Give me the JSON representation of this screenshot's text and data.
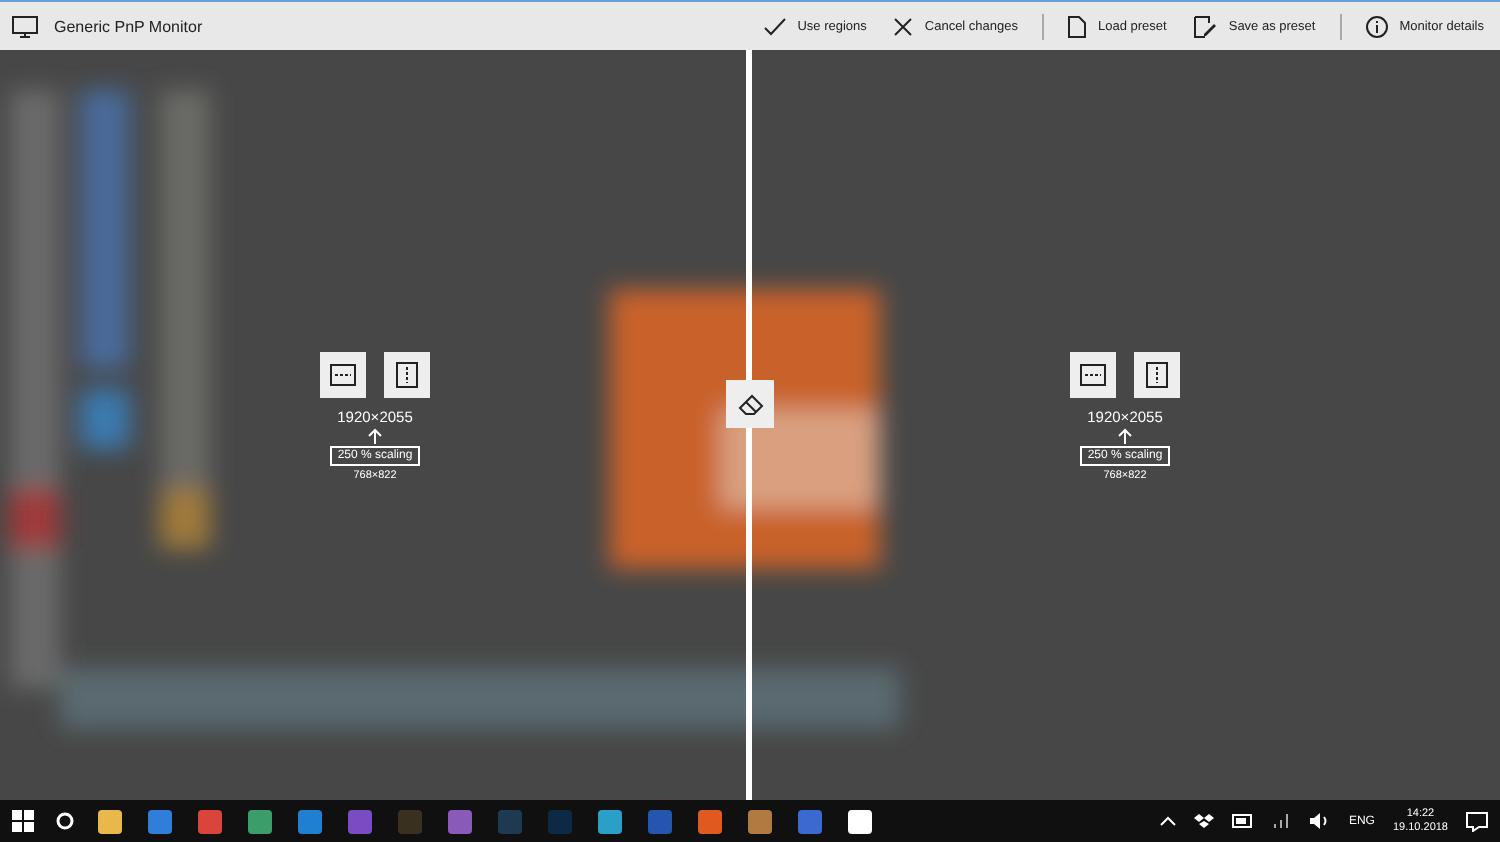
{
  "window": {
    "title": "Generic PnP Monitor"
  },
  "toolbar_groups": [
    [
      {
        "label": "Use regions"
      },
      {
        "label": "Cancel changes"
      }
    ],
    [
      {
        "label": "Load preset"
      },
      {
        "label": "Save as preset"
      }
    ],
    [
      {
        "label": "Monitor details"
      }
    ]
  ],
  "regions": [
    {
      "resolution": "1920×2055",
      "scaling": "250 % scaling",
      "effective": "768×822"
    },
    {
      "resolution": "1920×2055",
      "scaling": "250 % scaling",
      "effective": "768×822"
    }
  ],
  "taskbar": {
    "language": "ENG",
    "time": "14:22",
    "date": "19.10.2018"
  }
}
